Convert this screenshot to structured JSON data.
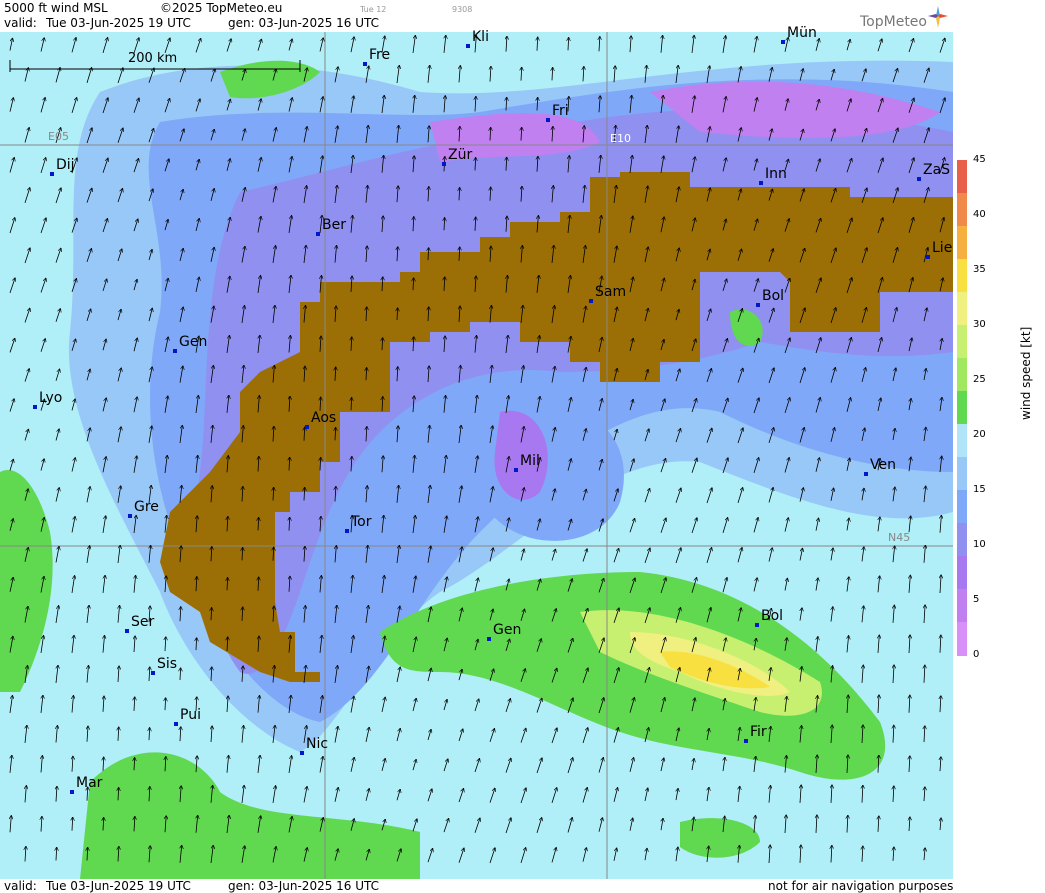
{
  "header": {
    "product": "5000 ft wind MSL",
    "copyright": "©2025 TopMeteo.eu",
    "valid_label": "valid:",
    "valid": "Tue  03-Jun-2025  19 UTC",
    "gen": "gen: 03-Jun-2025 16 UTC",
    "faint1": "Tue 12",
    "faint2": "9308",
    "logo": "TopMeteo"
  },
  "footer": {
    "valid_label": "valid:",
    "valid": "Tue  03-Jun-2025  19 UTC",
    "gen": "gen: 03-Jun-2025 16 UTC",
    "disclaimer": "not for air navigation purposes"
  },
  "scale_bar": {
    "label": "200 km"
  },
  "grid_labels": {
    "e05": "E05",
    "e10": "E10",
    "n45": "N45"
  },
  "cities": [
    {
      "name": "Kli"
    },
    {
      "name": "Mün"
    },
    {
      "name": "Fre"
    },
    {
      "name": "Fri"
    },
    {
      "name": "Dij"
    },
    {
      "name": "Zür"
    },
    {
      "name": "Inn"
    },
    {
      "name": "ZaS"
    },
    {
      "name": "Ber"
    },
    {
      "name": "Lie"
    },
    {
      "name": "Sam"
    },
    {
      "name": "Bol"
    },
    {
      "name": "Gen"
    },
    {
      "name": "Lyo"
    },
    {
      "name": "Aos"
    },
    {
      "name": "Mil"
    },
    {
      "name": "Ven"
    },
    {
      "name": "Gre"
    },
    {
      "name": "Tor"
    },
    {
      "name": "Ser"
    },
    {
      "name": "Gen"
    },
    {
      "name": "Bol"
    },
    {
      "name": "Sis"
    },
    {
      "name": "Pui"
    },
    {
      "name": "Nic"
    },
    {
      "name": "Fir"
    },
    {
      "name": "Mar"
    }
  ],
  "legend": {
    "title": "wind speed [kt]",
    "ticks": [
      "45",
      "40",
      "35",
      "30",
      "25",
      "20",
      "15",
      "10",
      "5",
      "0"
    ],
    "colors": [
      "#e8604a",
      "#f08a4a",
      "#f5b040",
      "#f8e040",
      "#f0f080",
      "#c8f070",
      "#a0e860",
      "#60d850",
      "#b0e4f8",
      "#98c8f8",
      "#80a8f8",
      "#9090f0",
      "#a878f0",
      "#c080f0",
      "#d890f8"
    ]
  },
  "colors": {
    "terrain": "#9b6f05",
    "bg": "#b0eef8"
  }
}
